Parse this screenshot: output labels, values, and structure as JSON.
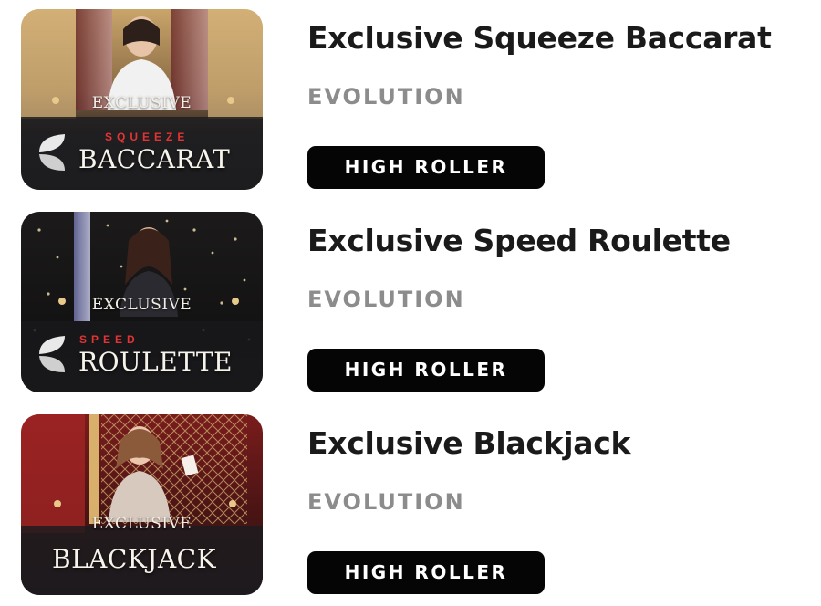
{
  "games": [
    {
      "title": "Exclusive Squeeze Baccarat",
      "provider": "EVOLUTION",
      "tag": "HIGH ROLLER",
      "thumbnail": {
        "exclusive": "EXCLUSIVE",
        "subtitle": "SQUEEZE",
        "name": "BACCARAT",
        "theme": "baccarat"
      }
    },
    {
      "title": "Exclusive Speed Roulette",
      "provider": "EVOLUTION",
      "tag": "HIGH ROLLER",
      "thumbnail": {
        "exclusive": "EXCLUSIVE",
        "subtitle": "SPEED",
        "name": "ROULETTE",
        "theme": "roulette"
      }
    },
    {
      "title": "Exclusive Blackjack",
      "provider": "EVOLUTION",
      "tag": "HIGH ROLLER",
      "thumbnail": {
        "exclusive": "EXCLUSIVE",
        "subtitle": "",
        "name": "BLACKJACK",
        "theme": "blackjack"
      }
    }
  ],
  "colors": {
    "tag_bg": "#050505",
    "title_text": "#1a1a1a",
    "provider_text": "#8c8c8c",
    "accent_red": "#e23434"
  }
}
